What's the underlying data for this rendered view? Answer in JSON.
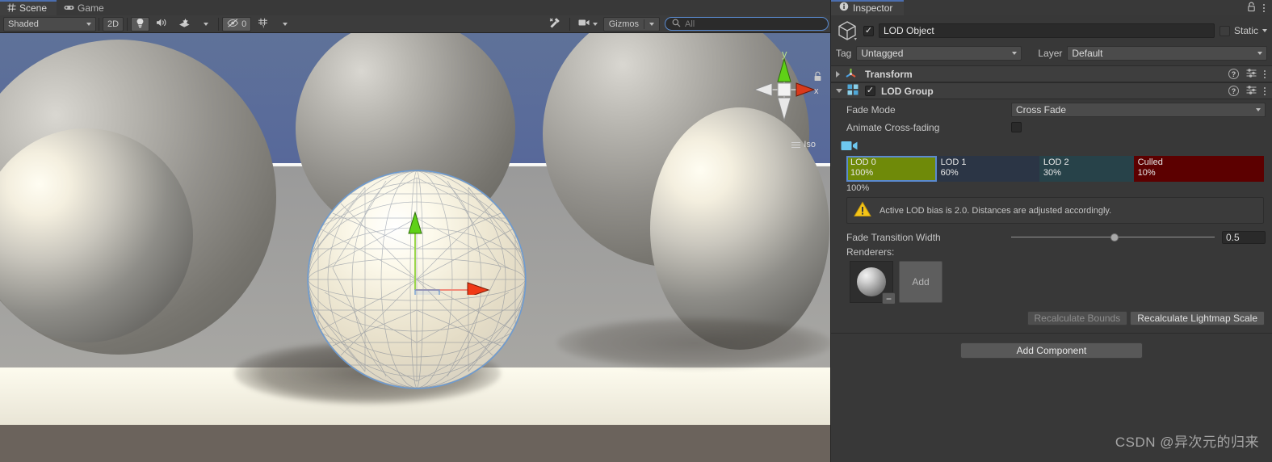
{
  "scene_panel": {
    "tabs": [
      {
        "label": "Scene",
        "icon": "grid-icon",
        "active": true
      },
      {
        "label": "Game",
        "icon": "gamepad-icon",
        "active": false
      }
    ],
    "toolbar": {
      "draw_mode": "Shaded",
      "two_d_label": "2D",
      "lighting_icon": "lightbulb-icon",
      "audio_icon": "speaker-icon",
      "effects_icon": "effects-icon",
      "hidden_objects_icon": "eye-slash-icon",
      "hidden_objects_count": "0",
      "grid_icon": "grid-visibility-icon",
      "tools_icon": "tools-icon",
      "camera_icon": "camera-icon",
      "gizmos_label": "Gizmos",
      "search_placeholder": "All",
      "search_value": ""
    },
    "viewport": {
      "orientation_label": "Iso",
      "axis_y_label": "y",
      "axis_x_label": "x",
      "lock_icon": "lock-icon",
      "sky_color": "#5b6e99",
      "ground_color": "#f4efdd",
      "foreground_color": "#6b635c",
      "selection_outline_color": "#6c9bd2"
    }
  },
  "inspector": {
    "tab_label": "Inspector",
    "tab_icon": "info-icon",
    "lock_icon": "lock-icon",
    "menu_icon": "kebab-menu-icon",
    "game_object": {
      "icon": "cube-icon",
      "enabled": true,
      "name": "LOD Object",
      "static_label": "Static",
      "static_checked": false,
      "tag_label": "Tag",
      "tag_value": "Untagged",
      "layer_label": "Layer",
      "layer_value": "Default"
    },
    "components": [
      {
        "name": "Transform",
        "icon": "transform-axis-icon",
        "expanded": false,
        "has_checkbox": false
      },
      {
        "name": "LOD Group",
        "icon": "lod-group-icon",
        "expanded": true,
        "has_checkbox": true,
        "enabled": true
      }
    ],
    "lod_group": {
      "fade_mode_label": "Fade Mode",
      "fade_mode_value": "Cross Fade",
      "animate_cross_fading_label": "Animate Cross-fading",
      "animate_cross_fading_checked": false,
      "camera_icon": "camera-icon",
      "levels": [
        {
          "name": "LOD 0",
          "percent": "100%",
          "width_pct": 21.6,
          "color": "#6f8a09",
          "selected": true
        },
        {
          "name": "LOD 1",
          "percent": "60%",
          "width_pct": 24.6,
          "color": "#2b3545",
          "selected": false
        },
        {
          "name": "LOD 2",
          "percent": "30%",
          "width_pct": 22.6,
          "color": "#274249",
          "selected": false
        },
        {
          "name": "Culled",
          "percent": "10%",
          "width_pct": 31.2,
          "color": "#5c0000",
          "selected": false
        }
      ],
      "current_percent_label": "100%",
      "warning_icon": "warning-triangle-icon",
      "warning_text": "Active LOD bias is 2.0. Distances are adjusted accordingly.",
      "fade_transition_label": "Fade Transition Width",
      "fade_transition_value": "0.5",
      "fade_transition_knob_pct": 49,
      "renderers_label": "Renderers:",
      "renderer_thumb_icon": "mesh-sphere-icon",
      "renderer_remove_label": "−",
      "renderer_add_label": "Add",
      "recalculate_bounds_label": "Recalculate Bounds",
      "recalculate_bounds_disabled": true,
      "recalculate_lightmap_label": "Recalculate Lightmap Scale",
      "recalculate_lightmap_disabled": false
    },
    "add_component_label": "Add Component"
  },
  "watermark": {
    "text": "CSDN @异次元的归来"
  },
  "colors": {
    "panel_bg": "#383838",
    "header_bg": "#3e3e3e",
    "accent_blue": "#4b6eaf",
    "selection_blue": "#5b8ad0",
    "text": "#c4c4c4"
  }
}
